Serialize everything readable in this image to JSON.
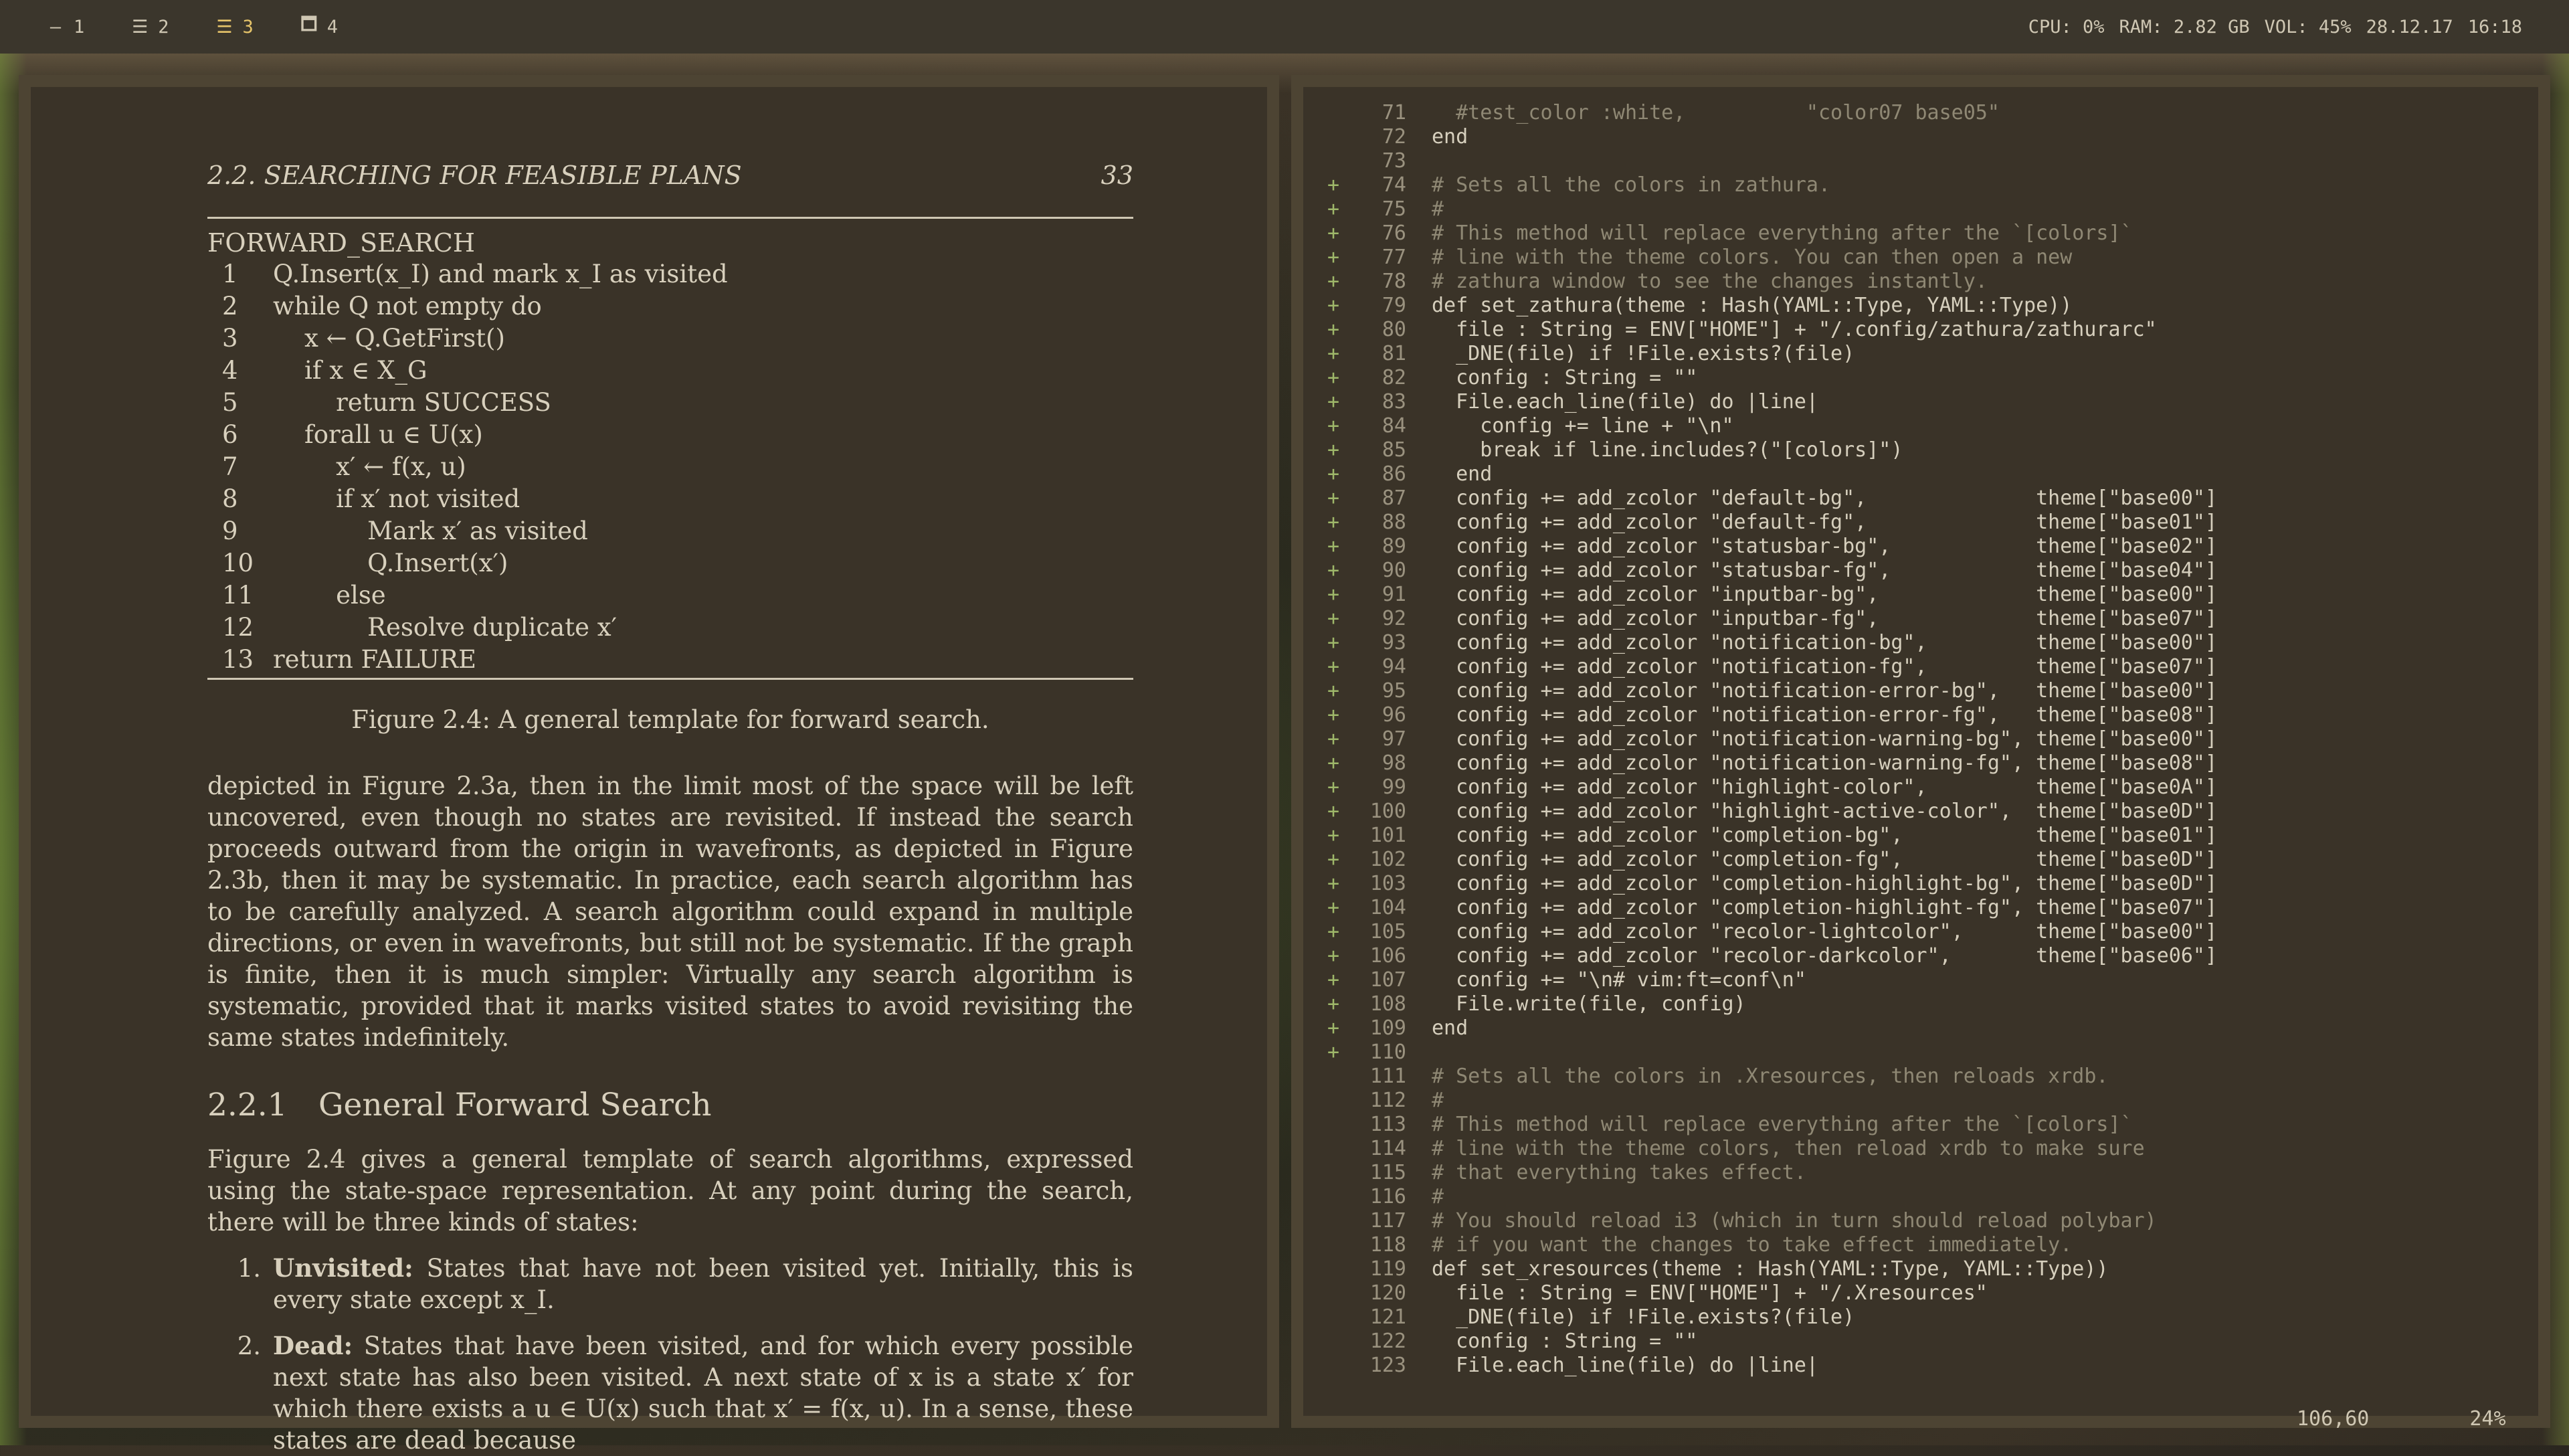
{
  "topbar": {
    "workspaces": [
      {
        "glyph": "—",
        "label": "1"
      },
      {
        "glyph": "☰",
        "label": "2"
      },
      {
        "glyph": "☰",
        "label": "3",
        "active": true
      },
      {
        "glyph": "🗖",
        "label": "4"
      }
    ],
    "status": [
      "CPU: 0%",
      "RAM: 2.82 GB",
      "VOL: 45%",
      "28.12.17",
      "16:18"
    ]
  },
  "pdf": {
    "section": "2.2.  SEARCHING FOR FEASIBLE PLANS",
    "page_number": "33",
    "algo_title": "FORWARD_SEARCH",
    "algo_lines": [
      {
        "n": "1",
        "t": "Q.Insert(x_I) and mark x_I as visited"
      },
      {
        "n": "2",
        "t": "while Q not empty do"
      },
      {
        "n": "3",
        "t": "    x ← Q.GetFirst()"
      },
      {
        "n": "4",
        "t": "    if x ∈ X_G"
      },
      {
        "n": "5",
        "t": "        return SUCCESS"
      },
      {
        "n": "6",
        "t": "    forall u ∈ U(x)"
      },
      {
        "n": "7",
        "t": "        x′ ← f(x, u)"
      },
      {
        "n": "8",
        "t": "        if x′ not visited"
      },
      {
        "n": "9",
        "t": "            Mark x′ as visited"
      },
      {
        "n": "10",
        "t": "            Q.Insert(x′)"
      },
      {
        "n": "11",
        "t": "        else"
      },
      {
        "n": "12",
        "t": "            Resolve duplicate x′"
      },
      {
        "n": "13",
        "t": "return FAILURE"
      }
    ],
    "caption": "Figure 2.4: A general template for forward search.",
    "paragraph1": "depicted in Figure 2.3a, then in the limit most of the space will be left uncovered, even though no states are revisited. If instead the search proceeds outward from the origin in wavefronts, as depicted in Figure 2.3b, then it may be systematic. In practice, each search algorithm has to be carefully analyzed. A search algorithm could expand in multiple directions, or even in wavefronts, but still not be systematic. If the graph is finite, then it is much simpler: Virtually any search algorithm is systematic, provided that it marks visited states to avoid revisiting the same states indefinitely.",
    "subsection_number": "2.2.1",
    "subsection_title": "General Forward Search",
    "paragraph2": "Figure 2.4 gives a general template of search algorithms, expressed using the state-space representation. At any point during the search, there will be three kinds of states:",
    "items": [
      {
        "idx": "1.",
        "term": "Unvisited:",
        "text": " States that have not been visited yet. Initially, this is every state except x_I."
      },
      {
        "idx": "2.",
        "term": "Dead:",
        "text": " States that have been visited, and for which every possible next state has also been visited. A next state of x is a state x′ for which there exists a u ∈ U(x) such that x′ = f(x, u). In a sense, these states are dead because"
      }
    ]
  },
  "editor": {
    "lines": [
      {
        "n": "71",
        "g": "",
        "code": "  #test_color :white,          \"color07 base05\""
      },
      {
        "n": "72",
        "g": "",
        "code": "end"
      },
      {
        "n": "73",
        "g": "",
        "code": ""
      },
      {
        "n": "74",
        "g": "+",
        "code": "# Sets all the colors in zathura."
      },
      {
        "n": "75",
        "g": "+",
        "code": "#"
      },
      {
        "n": "76",
        "g": "+",
        "code": "# This method will replace everything after the `[colors]`"
      },
      {
        "n": "77",
        "g": "+",
        "code": "# line with the theme colors. You can then open a new"
      },
      {
        "n": "78",
        "g": "+",
        "code": "# zathura window to see the changes instantly."
      },
      {
        "n": "79",
        "g": "+",
        "code": "def set_zathura(theme : Hash(YAML::Type, YAML::Type))"
      },
      {
        "n": "80",
        "g": "+",
        "code": "  file : String = ENV[\"HOME\"] + \"/.config/zathura/zathurarc\""
      },
      {
        "n": "81",
        "g": "+",
        "code": "  _DNE(file) if !File.exists?(file)"
      },
      {
        "n": "82",
        "g": "+",
        "code": "  config : String = \"\""
      },
      {
        "n": "83",
        "g": "+",
        "code": "  File.each_line(file) do |line|"
      },
      {
        "n": "84",
        "g": "+",
        "code": "    config += line + \"\\n\""
      },
      {
        "n": "85",
        "g": "+",
        "code": "    break if line.includes?(\"[colors]\")"
      },
      {
        "n": "86",
        "g": "+",
        "code": "  end"
      },
      {
        "n": "87",
        "g": "+",
        "code": "  config += add_zcolor \"default-bg\",              theme[\"base00\"]"
      },
      {
        "n": "88",
        "g": "+",
        "code": "  config += add_zcolor \"default-fg\",              theme[\"base01\"]"
      },
      {
        "n": "89",
        "g": "+",
        "code": "  config += add_zcolor \"statusbar-bg\",            theme[\"base02\"]"
      },
      {
        "n": "90",
        "g": "+",
        "code": "  config += add_zcolor \"statusbar-fg\",            theme[\"base04\"]"
      },
      {
        "n": "91",
        "g": "+",
        "code": "  config += add_zcolor \"inputbar-bg\",             theme[\"base00\"]"
      },
      {
        "n": "92",
        "g": "+",
        "code": "  config += add_zcolor \"inputbar-fg\",             theme[\"base07\"]"
      },
      {
        "n": "93",
        "g": "+",
        "code": "  config += add_zcolor \"notification-bg\",         theme[\"base00\"]"
      },
      {
        "n": "94",
        "g": "+",
        "code": "  config += add_zcolor \"notification-fg\",         theme[\"base07\"]"
      },
      {
        "n": "95",
        "g": "+",
        "code": "  config += add_zcolor \"notification-error-bg\",   theme[\"base00\"]"
      },
      {
        "n": "96",
        "g": "+",
        "code": "  config += add_zcolor \"notification-error-fg\",   theme[\"base08\"]"
      },
      {
        "n": "97",
        "g": "+",
        "code": "  config += add_zcolor \"notification-warning-bg\", theme[\"base00\"]"
      },
      {
        "n": "98",
        "g": "+",
        "code": "  config += add_zcolor \"notification-warning-fg\", theme[\"base08\"]"
      },
      {
        "n": "99",
        "g": "+",
        "code": "  config += add_zcolor \"highlight-color\",         theme[\"base0A\"]"
      },
      {
        "n": "100",
        "g": "+",
        "code": "  config += add_zcolor \"highlight-active-color\",  theme[\"base0D\"]"
      },
      {
        "n": "101",
        "g": "+",
        "code": "  config += add_zcolor \"completion-bg\",           theme[\"base01\"]"
      },
      {
        "n": "102",
        "g": "+",
        "code": "  config += add_zcolor \"completion-fg\",           theme[\"base0D\"]"
      },
      {
        "n": "103",
        "g": "+",
        "code": "  config += add_zcolor \"completion-highlight-bg\", theme[\"base0D\"]"
      },
      {
        "n": "104",
        "g": "+",
        "code": "  config += add_zcolor \"completion-highlight-fg\", theme[\"base07\"]"
      },
      {
        "n": "105",
        "g": "+",
        "code": "  config += add_zcolor \"recolor-lightcolor\",      theme[\"base00\"]"
      },
      {
        "n": "106",
        "g": "+",
        "code": "  config += add_zcolor \"recolor-darkcolor\",       theme[\"base06\"]"
      },
      {
        "n": "107",
        "g": "+",
        "code": "  config += \"\\n# vim:ft=conf\\n\""
      },
      {
        "n": "108",
        "g": "+",
        "code": "  File.write(file, config)"
      },
      {
        "n": "109",
        "g": "+",
        "code": "end"
      },
      {
        "n": "110",
        "g": "+",
        "code": ""
      },
      {
        "n": "111",
        "g": "",
        "code": "# Sets all the colors in .Xresources, then reloads xrdb."
      },
      {
        "n": "112",
        "g": "",
        "code": "#"
      },
      {
        "n": "113",
        "g": "",
        "code": "# This method will replace everything after the `[colors]`"
      },
      {
        "n": "114",
        "g": "",
        "code": "# line with the theme colors, then reload xrdb to make sure"
      },
      {
        "n": "115",
        "g": "",
        "code": "# that everything takes effect."
      },
      {
        "n": "116",
        "g": "",
        "code": "#"
      },
      {
        "n": "117",
        "g": "",
        "code": "# You should reload i3 (which in turn should reload polybar)"
      },
      {
        "n": "118",
        "g": "",
        "code": "# if you want the changes to take effect immediately."
      },
      {
        "n": "119",
        "g": "",
        "code": "def set_xresources(theme : Hash(YAML::Type, YAML::Type))"
      },
      {
        "n": "120",
        "g": "",
        "code": "  file : String = ENV[\"HOME\"] + \"/.Xresources\""
      },
      {
        "n": "121",
        "g": "",
        "code": "  _DNE(file) if !File.exists?(file)"
      },
      {
        "n": "122",
        "g": "",
        "code": "  config : String = \"\""
      },
      {
        "n": "123",
        "g": "",
        "code": "  File.each_line(file) do |line|"
      }
    ],
    "cursor_pos": "106,60",
    "scroll_pct": "24%"
  }
}
